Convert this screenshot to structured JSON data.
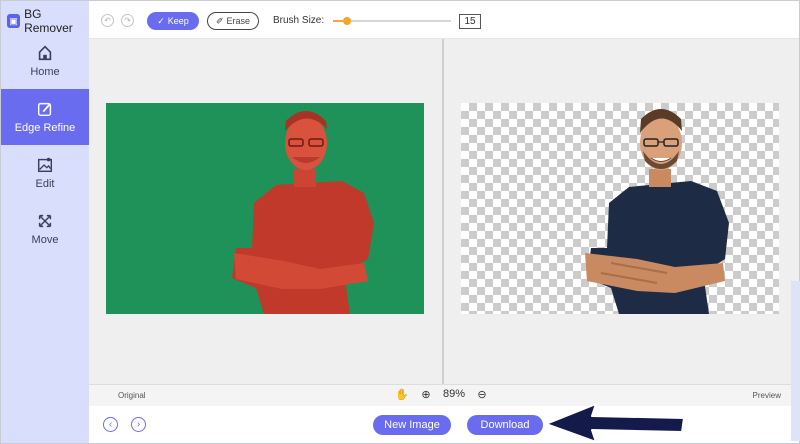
{
  "app": {
    "title": "BG Remover"
  },
  "sidebar": {
    "items": [
      {
        "label": "Home",
        "icon": "home-icon",
        "active": false
      },
      {
        "label": "Edge Refine",
        "icon": "edge-refine-icon",
        "active": true
      },
      {
        "label": "Edit",
        "icon": "image-edit-icon",
        "active": false
      },
      {
        "label": "Move",
        "icon": "move-icon",
        "active": false
      }
    ]
  },
  "toolbar": {
    "keep_label": "Keep",
    "erase_label": "Erase",
    "brush_size_label": "Brush Size:",
    "brush_size_value": "15"
  },
  "status": {
    "original_label": "Original",
    "preview_label": "Preview",
    "zoom": "89%"
  },
  "actions": {
    "new_image_label": "New Image",
    "download_label": "Download"
  },
  "colors": {
    "accent": "#6a6cf0",
    "sidebar_bg": "#d8defb",
    "photo_green": "#1e9258",
    "overlay_red": "#c8402f",
    "shirt_navy": "#1d2b45",
    "slider_orange": "#f5a623",
    "arrow_navy": "#141a4a"
  }
}
